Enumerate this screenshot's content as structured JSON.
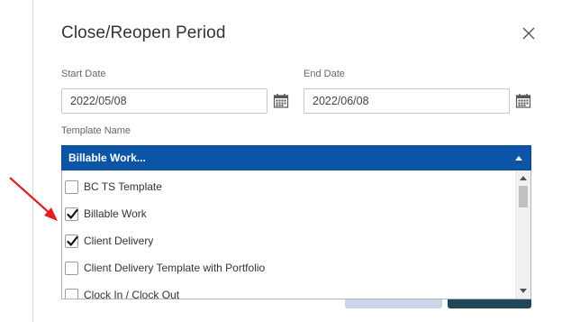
{
  "dialog": {
    "title": "Close/Reopen Period",
    "close_icon": "close-x-icon"
  },
  "start_date": {
    "label": "Start Date",
    "value": "2022/05/08",
    "icon": "calendar-icon"
  },
  "end_date": {
    "label": "End Date",
    "value": "2022/06/08",
    "icon": "calendar-icon"
  },
  "template": {
    "label": "Template Name",
    "selected_text": "Billable Work...",
    "header_color": "#0c55a6",
    "options": [
      {
        "label": "BC TS Template",
        "checked": false
      },
      {
        "label": "Billable Work",
        "checked": true
      },
      {
        "label": "Client Delivery",
        "checked": true
      },
      {
        "label": "Client Delivery Template with Portfolio",
        "checked": false
      },
      {
        "label": "Clock In / Clock Out",
        "checked": false
      }
    ]
  },
  "annotation": {
    "arrow_color": "#e02020"
  }
}
